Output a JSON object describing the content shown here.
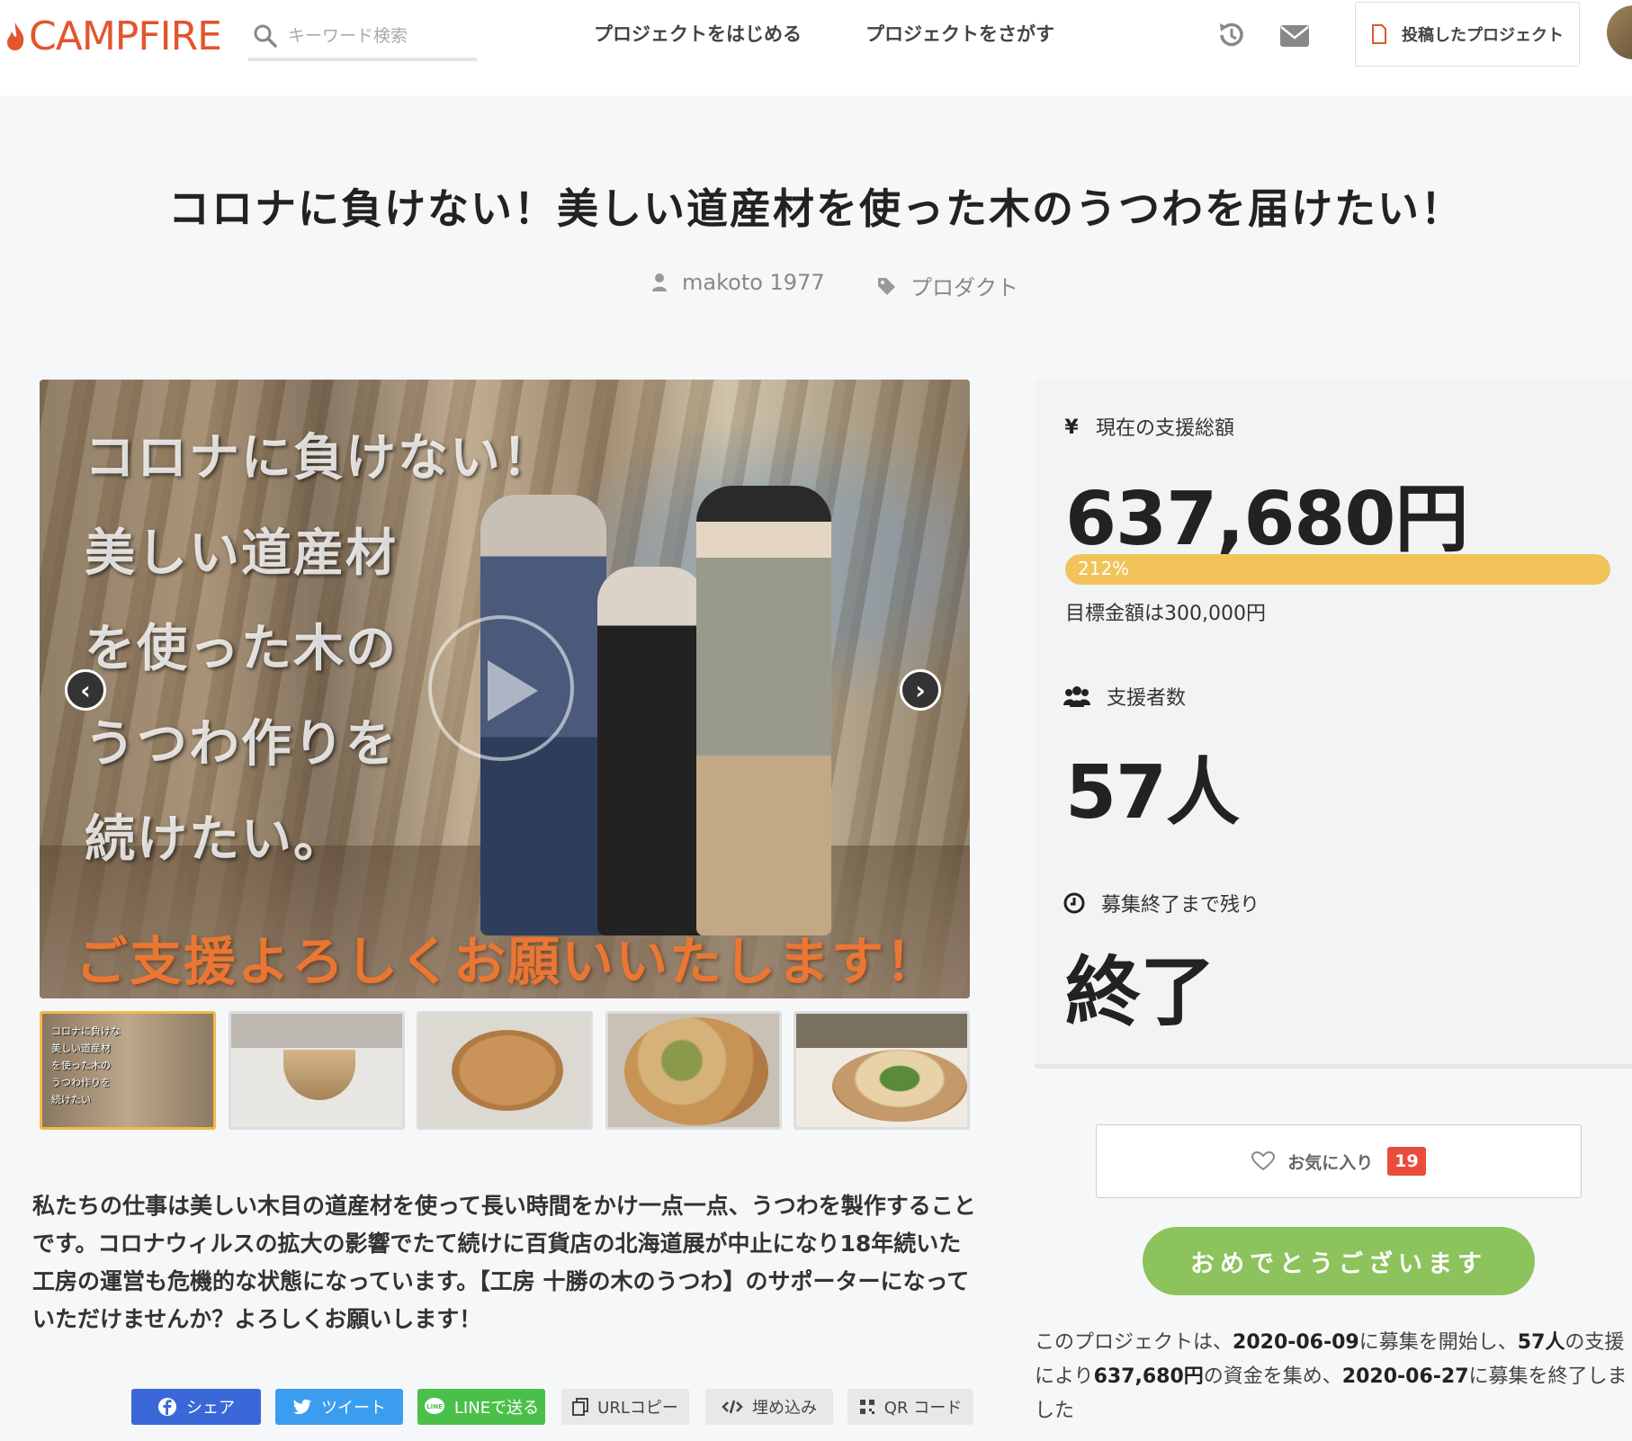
{
  "header": {
    "logo_text": "CAMPFIRE",
    "search_placeholder": "キーワード検索",
    "nav_start": "プロジェクトをはじめる",
    "nav_find": "プロジェクトをさがす",
    "my_projects": "投稿したプロジェクト"
  },
  "project": {
    "title": "コロナに負けない！美しい道産材を使った木のうつわを届けたい！",
    "owner": "makoto 1977",
    "category": "プロダクト"
  },
  "main_image": {
    "overlay_lines": [
      "コロナに負けない！",
      "美しい道産材",
      "を使った木の",
      "うつわ作りを",
      "続けたい。"
    ],
    "overlay_bottom": "ご支援よろしくお願いいたします！"
  },
  "thumb_lines": [
    "コロナに負けな",
    "美しい道産材",
    "を使った木の",
    "うつわ作りを",
    "続けたい"
  ],
  "description": "私たちの仕事は美しい木目の道産材を使って長い時間をかけ一点一点、うつわを製作することです。コロナウィルスの拡大の影響でたて続けに百貨店の北海道展が中止になり18年続いた工房の運営も危機的な状態になっています。【工房 十勝の木のうつわ】のサポーターになっていただけませんか？よろしくお願いします！",
  "share": {
    "facebook": "シェア",
    "twitter": "ツイート",
    "line": "LINEで送る",
    "url": "URLコピー",
    "embed": "埋め込み",
    "qr": "QR コード"
  },
  "stats": {
    "total_label": "現在の支援総額",
    "total_value": "637,680円",
    "progress_percent": 212,
    "progress_label": "212%",
    "goal": "目標金額は300,000円",
    "backers_label": "支援者数",
    "backers_value": "57人",
    "remaining_label": "募集終了まで残り",
    "remaining_value": "終了"
  },
  "favorite": {
    "label": "お気に入り",
    "count": "19"
  },
  "congrats": "おめでとうございます",
  "summary": {
    "p1": "このプロジェクトは、",
    "start_date": "2020-06-09",
    "p2": "に募集を開始し、",
    "backers": "57人",
    "p3": "の支援により",
    "amount": "637,680円",
    "p4": "の資金を集め、",
    "end_date": "2020-06-27",
    "p5": "に募集を終了しました"
  },
  "colors": {
    "brand": "#e2552d",
    "progress": "#f2c35a",
    "congrats": "#8cc35c",
    "badge": "#e94b3c"
  }
}
